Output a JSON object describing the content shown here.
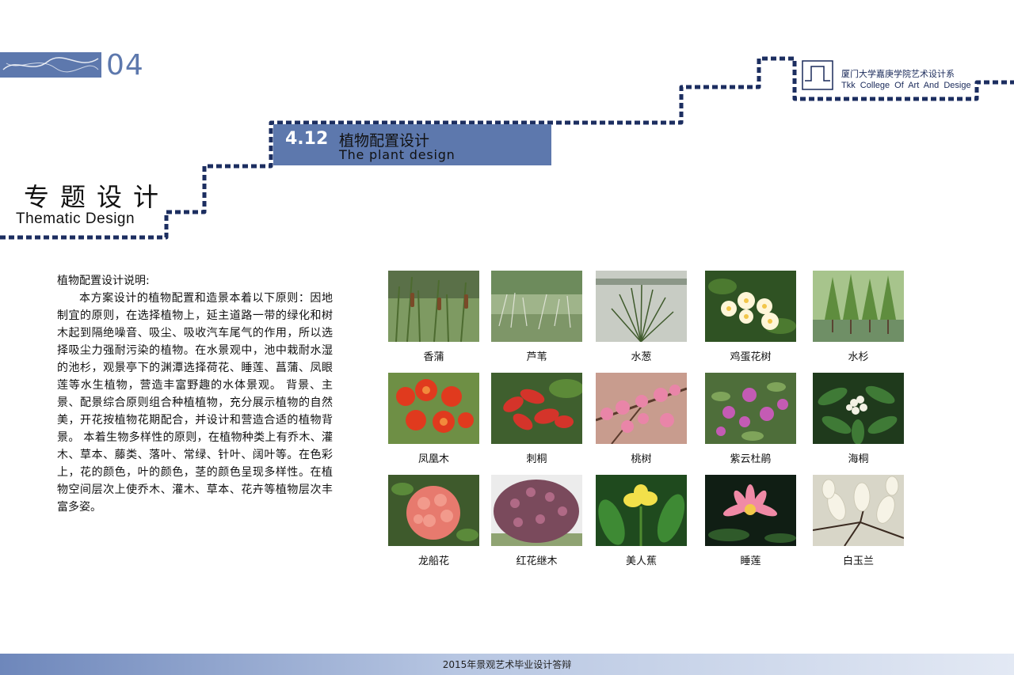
{
  "section": {
    "number": "04"
  },
  "thematic": {
    "title_cn": "专题设计",
    "title_en": "Thematic Design"
  },
  "page_title": {
    "number": "4.12",
    "title_cn": "植物配置设计",
    "title_en": "The plant design"
  },
  "college": {
    "name_cn": "厦门大学嘉庚学院艺术设计系",
    "name_en": "Tkk College Of Art And Desige"
  },
  "description": {
    "heading": "植物配置设计说明:",
    "body": "本方案设计的植物配置和造景本着以下原则：因地制宜的原则，在选择植物上，延主道路一带的绿化和树木起到隔绝噪音、吸尘、吸收汽车尾气的作用，所以选择吸尘力强耐污染的植物。在水景观中，池中栽耐水湿的池杉，观景亭下的渊潭选择荷花、睡莲、菖蒲、凤眼莲等水生植物，营造丰富野趣的水体景观。  背景、主景、配景综合原则组合种植植物，充分展示植物的自然美，开花按植物花期配合，并设计和营造合适的植物背景。  本着生物多样性的原则，在植物种类上有乔木、灌木、草本、藤类、落叶、常绿、针叶、阔叶等。在色彩上，花的颜色，叶的颜色，茎的颜色呈现多样性。在植物空间层次上使乔木、灌木、草本、花卉等植物层次丰富多姿。"
  },
  "plants": [
    {
      "name": "香蒲",
      "icon": "cattail-photo"
    },
    {
      "name": "芦苇",
      "icon": "reed-photo"
    },
    {
      "name": "水葱",
      "icon": "bulrush-photo"
    },
    {
      "name": "鸡蛋花树",
      "icon": "frangipani-photo"
    },
    {
      "name": "水杉",
      "icon": "metasequoia-photo"
    },
    {
      "name": "凤凰木",
      "icon": "flame-tree-photo"
    },
    {
      "name": "刺桐",
      "icon": "coral-tree-photo"
    },
    {
      "name": "桃树",
      "icon": "peach-tree-photo"
    },
    {
      "name": "紫云杜鹃",
      "icon": "purple-azalea-photo"
    },
    {
      "name": "海桐",
      "icon": "pittosporum-photo"
    },
    {
      "name": "龙船花",
      "icon": "ixora-photo"
    },
    {
      "name": "红花继木",
      "icon": "loropetalum-photo"
    },
    {
      "name": "美人蕉",
      "icon": "canna-photo"
    },
    {
      "name": "睡莲",
      "icon": "water-lily-photo"
    },
    {
      "name": "白玉兰",
      "icon": "magnolia-photo"
    }
  ],
  "footer": {
    "text": "2015年景观艺术毕业设计答辩"
  },
  "colors": {
    "accent": "#5d78ad",
    "dashed_line": "#1c2e60",
    "footer_start": "#6e87bb"
  }
}
